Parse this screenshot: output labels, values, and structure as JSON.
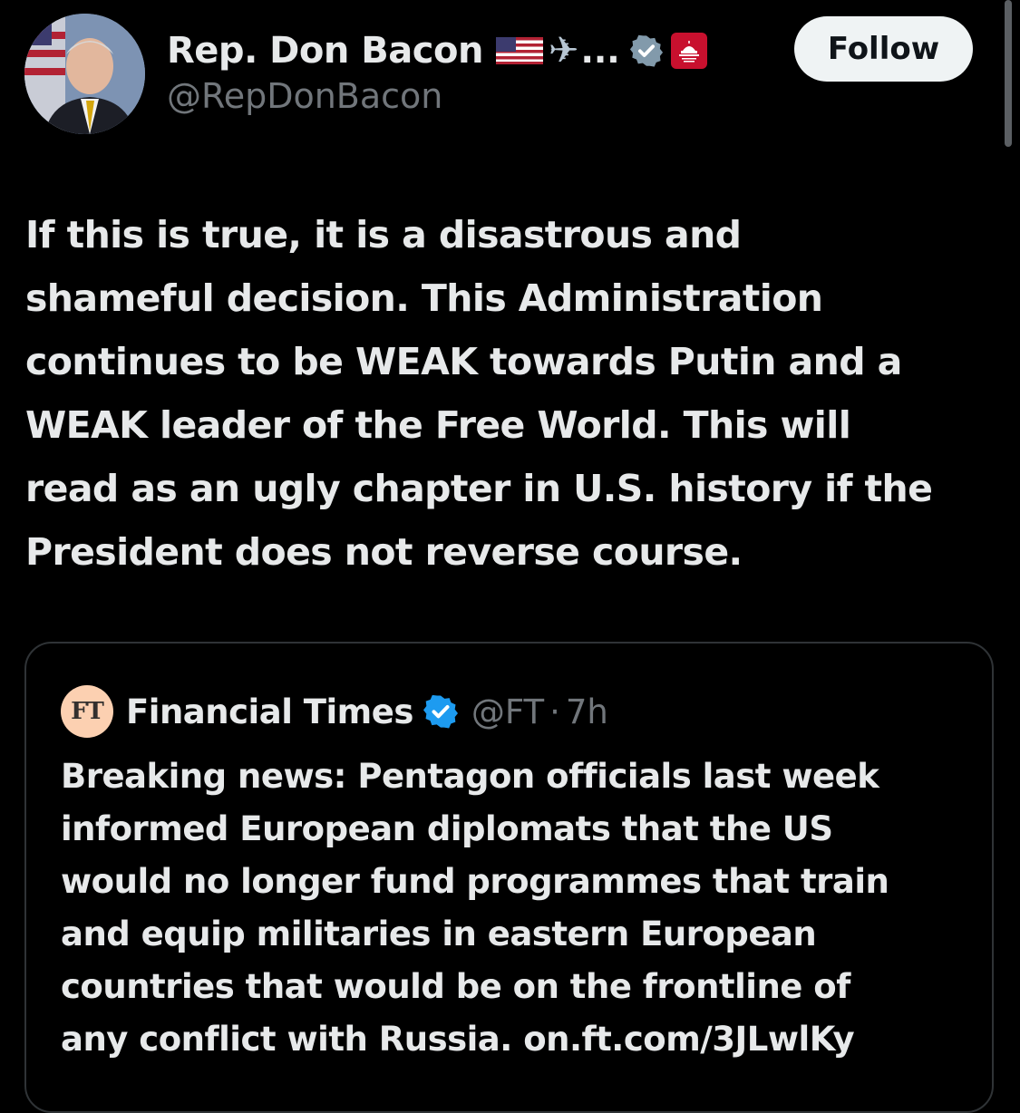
{
  "author": {
    "display_name": "Rep. Don Bacon",
    "ellipsis": "...",
    "handle": "@RepDonBacon",
    "badges": [
      "us-flag-icon",
      "airplane-icon",
      "verified-gray-icon",
      "house-gop-icon"
    ],
    "follow_label": "Follow"
  },
  "tweet": {
    "lines": [
      "If this is true, it is a disastrous and",
      "shameful decision. This Administration",
      "continues to be WEAK towards Putin and a",
      "WEAK leader of the Free World. This will",
      "read as an ugly chapter in U.S. history if the",
      "President does not reverse course."
    ]
  },
  "quoted": {
    "logo_text": "FT",
    "name": "Financial Times",
    "handle": "@FT",
    "separator": "·",
    "time": "7h",
    "lines": [
      "Breaking news: Pentagon officials last week",
      "informed European diplomats that the US",
      "would no longer fund programmes that train",
      "and equip militaries in eastern European",
      "countries that would be on the frontline of",
      "any conflict with Russia. on.ft.com/3JLwlKy"
    ]
  },
  "colors": {
    "background": "#000000",
    "text": "#e7e9ea",
    "secondary": "#71767b",
    "verified_blue": "#1d9bf0",
    "house_red": "#c8102e"
  }
}
